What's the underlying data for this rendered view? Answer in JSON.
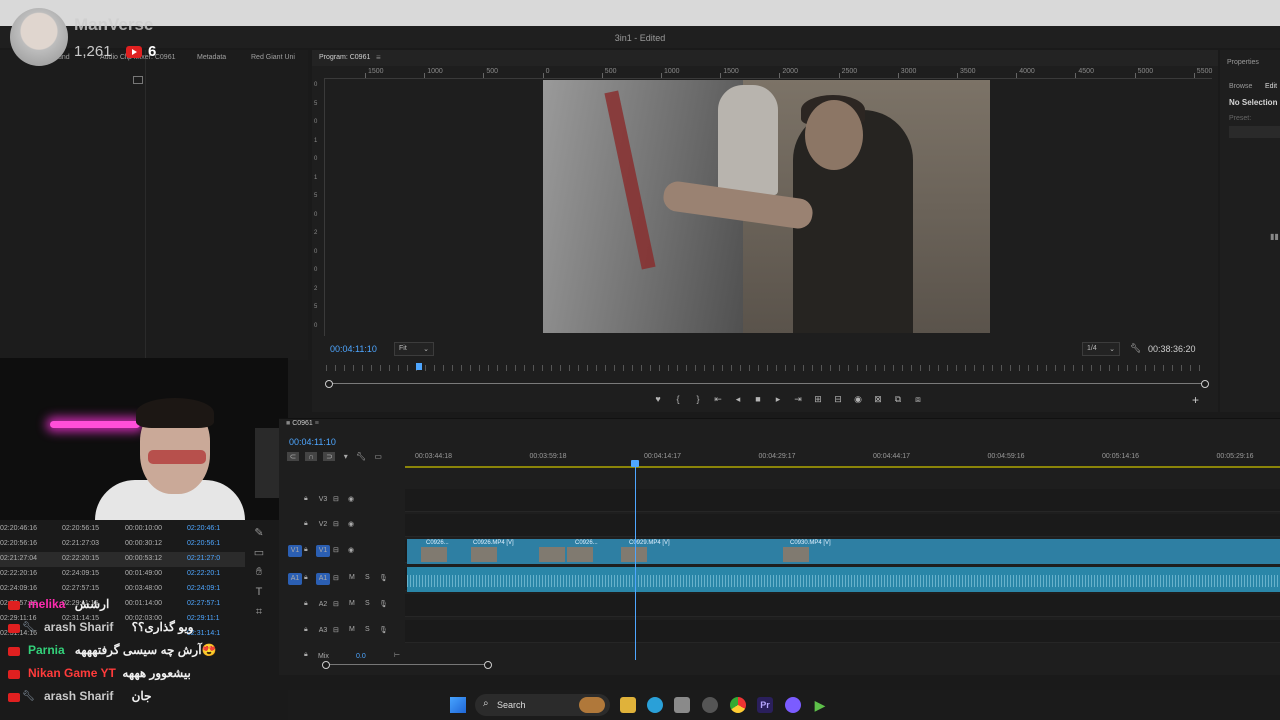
{
  "window": {
    "title": "3in1 - Edited"
  },
  "stream": {
    "channel_name": "ManVerse",
    "subscribers": "1,261",
    "live_viewers": "6"
  },
  "left_tabs": [
    "und",
    "Audio Clip Mixer: C0961",
    "Metadata",
    "Red Giant Uni"
  ],
  "program": {
    "tab_label": "Program: C0961",
    "ruler_labels": [
      "1500",
      "1000",
      "500",
      "0",
      "500",
      "1000",
      "1500",
      "2000",
      "2500",
      "3000",
      "3500",
      "4000",
      "4500",
      "5000",
      "5500"
    ],
    "vruler_labels": [
      "0",
      "5",
      "0",
      "1",
      "0",
      "1",
      "5",
      "0",
      "2",
      "0",
      "0",
      "2",
      "5",
      "0"
    ],
    "timecode": "00:04:11:10",
    "fit_label": "Fit",
    "quality_label": "1/4",
    "duration": "00:38:36:20",
    "transport": [
      "♥",
      "{",
      "}",
      "⇤",
      "◂",
      "■",
      "▸",
      "⇥",
      "⊞",
      "⊟",
      "◉",
      "⊠",
      "⧉",
      "⧈"
    ]
  },
  "properties": {
    "title": "Properties",
    "tabs": [
      "Browse",
      "Edit"
    ],
    "selection": "No Selection",
    "preset_label": "Preset:"
  },
  "table_rows": [
    [
      "02:20:46:16",
      "02:20:56:15",
      "00:00:10:00",
      "02:20:46:1"
    ],
    [
      "02:20:56:16",
      "02:21:27:03",
      "00:00:30:12",
      "02:20:56:1"
    ],
    [
      "02:21:27:04",
      "02:22:20:15",
      "00:00:53:12",
      "02:21:27:0"
    ],
    [
      "02:22:20:16",
      "02:24:09:15",
      "00:01:49:00",
      "02:22:20:1"
    ],
    [
      "02:24:09:16",
      "02:27:57:15",
      "00:03:48:00",
      "02:24:09:1"
    ],
    [
      "02:27:57:16",
      "02:29:11:15",
      "00:01:14:00",
      "02:27:57:1"
    ],
    [
      "02:29:11:16",
      "02:31:14:15",
      "00:02:03:00",
      "02:29:11:1"
    ],
    [
      "02:31:14:16",
      "",
      "",
      "02:31:14:1"
    ]
  ],
  "chat": [
    {
      "name": "melika",
      "text": "ارشش",
      "color": "#ff2bb0",
      "wrench": false
    },
    {
      "name": "arash Sharif",
      "text": "ویو گذاری؟؟",
      "color": "#c9c9c9",
      "wrench": true
    },
    {
      "name": "Parnia",
      "text": "آرش چه سیسی گرفتهههه😍",
      "color": "#33d17a",
      "wrench": false
    },
    {
      "name": "Nikan Game YT",
      "text": "بیشعوور هههه",
      "color": "#ff3b3b",
      "wrench": false
    },
    {
      "name": "arash Sharif",
      "text": "جان",
      "color": "#c9c9c9",
      "wrench": true
    }
  ],
  "timeline": {
    "sequence_tab": "C0961",
    "timecode": "00:04:11:10",
    "ruler_labels": [
      "00:03:44:18",
      "00:03:59:18",
      "00:04:14:17",
      "00:04:29:17",
      "00:04:44:17",
      "00:04:59:16",
      "00:05:14:16",
      "00:05:29:16"
    ],
    "tracks": [
      {
        "label": "V3",
        "target": "",
        "type": "video"
      },
      {
        "label": "V2",
        "target": "",
        "type": "video"
      },
      {
        "label": "V1",
        "target": "V1",
        "type": "video"
      },
      {
        "label": "A1",
        "target": "A1",
        "type": "audio"
      },
      {
        "label": "A2",
        "target": "",
        "type": "audio"
      },
      {
        "label": "A3",
        "target": "",
        "type": "audio"
      }
    ],
    "clips": [
      "C0926...",
      "C0926.MP4 [V]",
      "C0926...",
      "C0929.MP4 [V]",
      "C0930.MP4 [V]"
    ],
    "mix_label": "Mix",
    "mix_value": "0.0",
    "track_buttons": {
      "mute": "M",
      "solo": "S"
    }
  },
  "taskbar": {
    "search_placeholder": "Search"
  },
  "colors": {
    "timecode_blue": "#4ea6ff",
    "clip_teal": "#2e7fa3",
    "premiere_purple": "#2a1f5c"
  }
}
